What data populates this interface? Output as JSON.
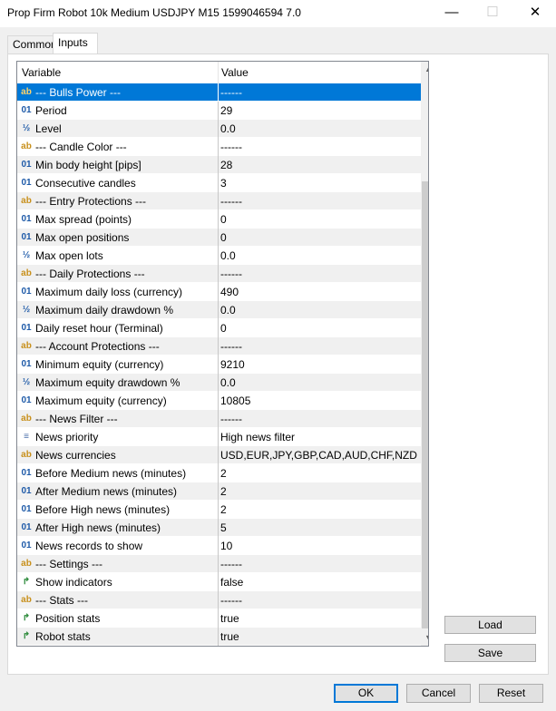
{
  "window": {
    "title": "Prop Firm Robot 10k Medium USDJPY M15 1599046594 7.0"
  },
  "tabs": [
    {
      "label": "Common"
    },
    {
      "label": "Inputs"
    }
  ],
  "grid": {
    "columns": {
      "variable": "Variable",
      "value": "Value"
    },
    "rows": [
      {
        "icon": "ab",
        "name": "--- Bulls Power ---",
        "value": "------"
      },
      {
        "icon": "01",
        "name": "Period",
        "value": "29"
      },
      {
        "icon": "½",
        "name": "Level",
        "value": "0.0"
      },
      {
        "icon": "ab",
        "name": "--- Candle Color ---",
        "value": "------"
      },
      {
        "icon": "01",
        "name": "Min body height [pips]",
        "value": "28"
      },
      {
        "icon": "01",
        "name": "Consecutive candles",
        "value": "3"
      },
      {
        "icon": "ab",
        "name": "--- Entry Protections ---",
        "value": "------"
      },
      {
        "icon": "01",
        "name": "Max spread (points)",
        "value": "0"
      },
      {
        "icon": "01",
        "name": "Max open positions",
        "value": "0"
      },
      {
        "icon": "½",
        "name": "Max open lots",
        "value": "0.0"
      },
      {
        "icon": "ab",
        "name": "--- Daily Protections ---",
        "value": "------"
      },
      {
        "icon": "01",
        "name": "Maximum daily loss (currency)",
        "value": "490"
      },
      {
        "icon": "½",
        "name": "Maximum daily drawdown %",
        "value": "0.0"
      },
      {
        "icon": "01",
        "name": "Daily reset hour (Terminal)",
        "value": "0"
      },
      {
        "icon": "ab",
        "name": "--- Account Protections ---",
        "value": "------"
      },
      {
        "icon": "01",
        "name": "Minimum equity (currency)",
        "value": "9210"
      },
      {
        "icon": "½",
        "name": "Maximum equity drawdown %",
        "value": "0.0"
      },
      {
        "icon": "01",
        "name": "Maximum equity (currency)",
        "value": "10805"
      },
      {
        "icon": "ab",
        "name": "--- News Filter ---",
        "value": "------"
      },
      {
        "icon": "≡",
        "name": "News priority",
        "value": "High news filter"
      },
      {
        "icon": "ab",
        "name": "News currencies",
        "value": "USD,EUR,JPY,GBP,CAD,AUD,CHF,NZD"
      },
      {
        "icon": "01",
        "name": "Before Medium news (minutes)",
        "value": "2"
      },
      {
        "icon": "01",
        "name": "After Medium news (minutes)",
        "value": "2"
      },
      {
        "icon": "01",
        "name": "Before High news (minutes)",
        "value": "2"
      },
      {
        "icon": "01",
        "name": "After High news (minutes)",
        "value": "5"
      },
      {
        "icon": "01",
        "name": "News records to show",
        "value": "10"
      },
      {
        "icon": "ab",
        "name": "--- Settings ---",
        "value": "------"
      },
      {
        "icon": "↱",
        "name": "Show indicators",
        "value": "false"
      },
      {
        "icon": "ab",
        "name": "--- Stats ---",
        "value": "------"
      },
      {
        "icon": "↱",
        "name": "Position stats",
        "value": "true"
      },
      {
        "icon": "↱",
        "name": "Robot stats",
        "value": "true"
      }
    ]
  },
  "side_buttons": {
    "load": "Load",
    "save": "Save"
  },
  "footer": {
    "ok": "OK",
    "cancel": "Cancel",
    "reset": "Reset"
  }
}
